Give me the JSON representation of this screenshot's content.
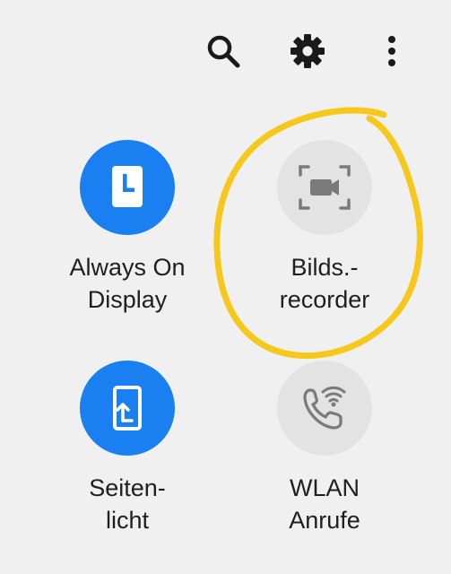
{
  "toolbar": {
    "search_icon": "search-icon",
    "settings_icon": "gear-icon",
    "more_icon": "more-vert-icon"
  },
  "tiles": [
    {
      "id": "always-on-display",
      "label_line1": "Always On",
      "label_line2": "Display",
      "icon": "clock-card-icon",
      "state": "on"
    },
    {
      "id": "screen-recorder",
      "label_line1": "Bilds.-",
      "label_line2": "recorder",
      "icon": "screen-record-icon",
      "state": "off"
    },
    {
      "id": "edge-lighting",
      "label_line1": "Seiten-",
      "label_line2": "licht",
      "icon": "edge-lighting-icon",
      "state": "on"
    },
    {
      "id": "wifi-calling",
      "label_line1": "WLAN",
      "label_line2": "Anrufe",
      "icon": "wifi-call-icon",
      "state": "off"
    }
  ],
  "colors": {
    "background": "#f0f0f0",
    "tile_on": "#1a7ff0",
    "tile_off": "#e3e3e3",
    "icon_off": "#7a7a7a",
    "highlight": "#f6c81c"
  }
}
